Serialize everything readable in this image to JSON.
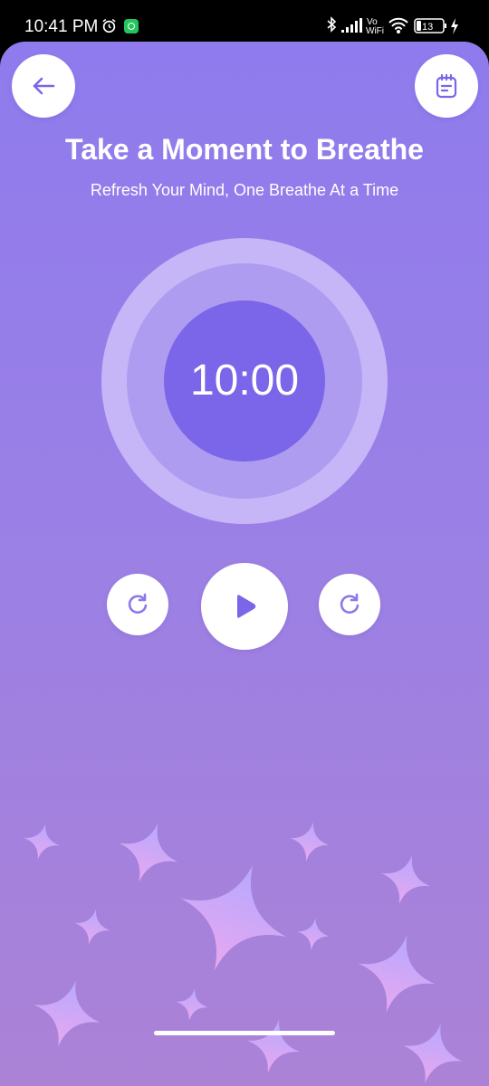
{
  "status_bar": {
    "time": "10:41 PM",
    "icons": [
      "alarm-icon",
      "app-notification-icon",
      "bluetooth-icon",
      "signal-icon",
      "vowifi-icon",
      "wifi-icon",
      "battery-icon",
      "charging-icon"
    ],
    "vowifi_label_top": "Vo",
    "vowifi_label_bottom": "WiFi",
    "battery_level": "13"
  },
  "header": {
    "back_icon": "arrow-left-icon",
    "notes_icon": "notepad-icon",
    "title": "Take a Moment to Breathe",
    "subtitle": "Refresh Your Mind, One Breathe At a Time"
  },
  "timer": {
    "value": "10:00"
  },
  "controls": {
    "left_icon": "restart-icon",
    "center_icon": "play-icon",
    "right_icon": "restart-icon"
  },
  "colors": {
    "accent": "#7b65e8",
    "gradient_top": "#8f7bed",
    "gradient_bottom": "#ab82d6"
  }
}
